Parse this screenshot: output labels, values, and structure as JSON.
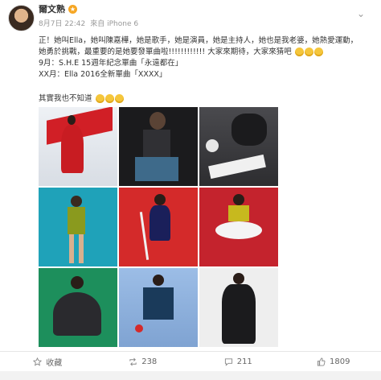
{
  "post": {
    "username": "爾文熟",
    "time": "8月7日 22:42",
    "source": "來自 iPhone 6",
    "line1": "正！她叫Ella，她叫陳嘉樺，她是歌手，她是演員，她是主持人，她也是我老婆，她熱愛運動，她勇於挑戰，最重要的是她要發單曲啦!!!!!!!!!!!! 大家來期待，大家來猜吧",
    "line2": "9月：S.H.E 15週年紀念單曲「永遠都在」",
    "line3": "XX月：Ella 2016全新單曲「XXXX」",
    "line4": "其實我也不知道"
  },
  "actions": {
    "favorite": "收藏",
    "repost": "238",
    "comment": "211",
    "like": "1809"
  },
  "colors": {
    "accent": "#f6a623",
    "photo_bgs": [
      "#e9edf2",
      "#1b1b1d",
      "#3a3a3d",
      "#1fa2b9",
      "#d42a2a",
      "#c4232d",
      "#1d8f5c",
      "#8fb0da",
      "#eeeeee"
    ]
  },
  "icons": [
    "vip-icon",
    "chevron-down-icon",
    "star-icon",
    "repost-icon",
    "comment-icon",
    "like-icon",
    "emoji-icon"
  ]
}
